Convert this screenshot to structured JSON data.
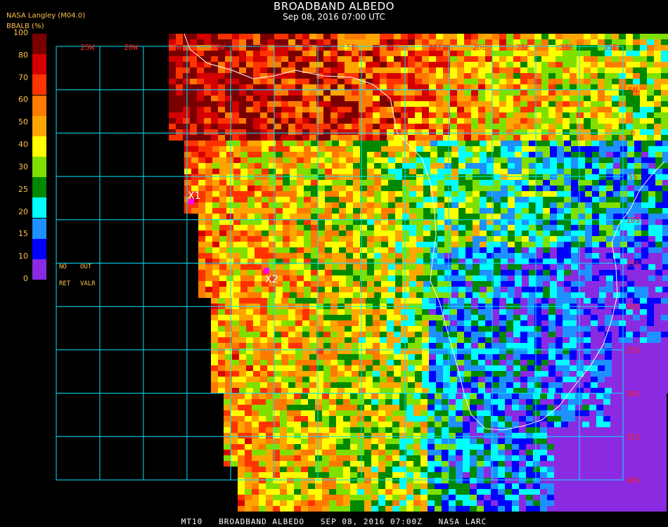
{
  "header": {
    "title": "BROADBAND ALBEDO",
    "datetime": "Sep 08, 2016 07:00 UTC",
    "product": "NASA Langley (M04.0)",
    "parameter": "BBALB (%)"
  },
  "legend": {
    "ticks": [
      "100",
      "80",
      "70",
      "60",
      "50",
      "40",
      "30",
      "25",
      "20",
      "15",
      "10",
      "0"
    ],
    "colors": [
      "#7a0000",
      "#d40000",
      "#ff3300",
      "#ff7a00",
      "#ffa500",
      "#ffff00",
      "#7fe000",
      "#008800",
      "#00ffff",
      "#1e90ff",
      "#0000ff",
      "#8a2be2"
    ],
    "nodata": {
      "no": "NO",
      "out": "OUT",
      "ret": "RET",
      "valr": "VALR"
    }
  },
  "grid": {
    "color": "#00e5ff",
    "lon_labels": [
      "25W",
      "20W",
      "15W",
      "10W",
      "5W",
      "0",
      "5E",
      "10E",
      "15E",
      "20E",
      "25E",
      "30E",
      "35E"
    ],
    "lat_labels": [
      "5N",
      "0",
      "5S",
      "10S",
      "15S",
      "20S",
      "25S",
      "30S",
      "35S",
      "40S"
    ]
  },
  "markers": [
    {
      "label": "X1",
      "color": "#ff00ff"
    },
    {
      "label": "X2",
      "color": "#ff00ff"
    }
  ],
  "footer": "MT10   BROADBAND ALBEDO   SEP 08, 2016 07:00Z   NASA LARC"
}
